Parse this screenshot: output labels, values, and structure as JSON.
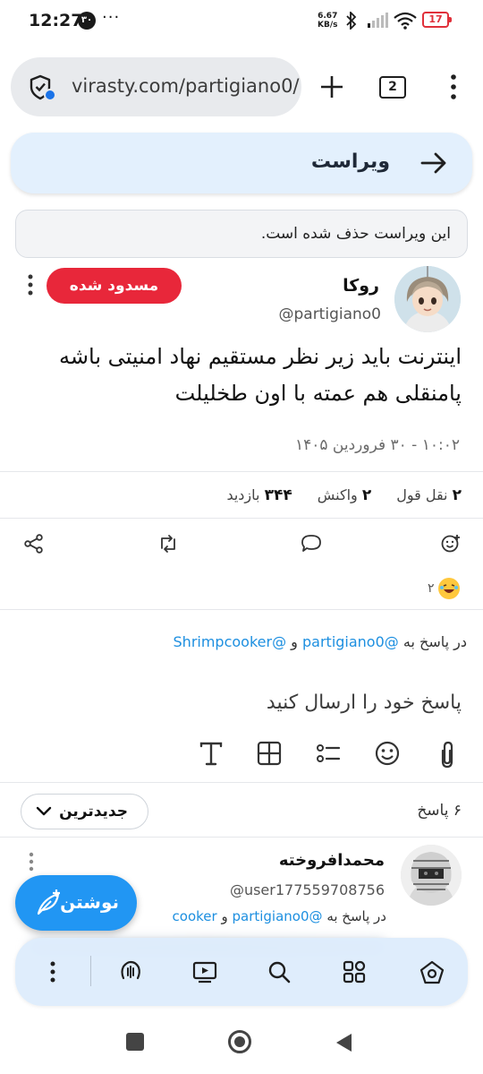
{
  "status_bar": {
    "time": "12:27",
    "notification_badge": "۳۰",
    "overflow": "···",
    "speed_value": "6.67",
    "speed_unit": "KB/s",
    "battery": "17"
  },
  "browser": {
    "url": "virasty.com/partigiano0/",
    "tab_count": "2"
  },
  "header": {
    "title": "ویراست"
  },
  "notice": {
    "text": "این ویراست حذف شده است."
  },
  "post": {
    "author_name": "روکا",
    "author_handle": "@partigiano0",
    "badge": "مسدود شده",
    "body_line_1": "اینترنت باید زیر نظر مستقیم نهاد امنیتی باشه",
    "body_line_2": "پامنقلی هم عمته با اون طخلیلت",
    "date": "۱۰:۰۲ - ۳۰ فروردین ۱۴۰۵",
    "stats": [
      {
        "value": "۲",
        "label": "نقل قول"
      },
      {
        "value": "۲",
        "label": "واکنش"
      },
      {
        "value": "۳۴۴",
        "label": "بازدید"
      }
    ],
    "reaction_count": "۲"
  },
  "reply_context": {
    "prefix": "در پاسخ به",
    "user1": "@partigiano0",
    "conj": "و",
    "user2": "@Shrimpcooker"
  },
  "composer": {
    "placeholder": "پاسخ خود را ارسال کنید"
  },
  "replies": {
    "count_label": "۶ پاسخ",
    "sort_label": "جدیدترین"
  },
  "reply_item": {
    "name": "محمدافروخته",
    "handle": "@user177559708756",
    "prefix": "در پاسخ به",
    "user1": "@partigiano0",
    "conj": "و",
    "user2_partial": "cooker"
  },
  "fab": {
    "label": "نوشتن"
  },
  "colors": {
    "accent": "#2196f3",
    "blocked": "#e8273a",
    "header_bg": "#e3f0fd"
  }
}
